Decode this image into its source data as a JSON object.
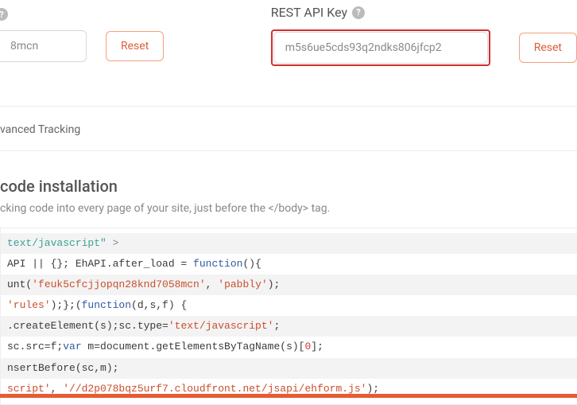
{
  "left": {
    "key_fragment": "8mcn",
    "reset_label": "Reset"
  },
  "right": {
    "label": "REST API Key",
    "key_value": "m5s6ue5cds93q2ndks806jfcp2",
    "reset_label": "Reset"
  },
  "tracking": {
    "text_fragment": "vanced Tracking"
  },
  "install": {
    "title_fragment": "code installation",
    "sub_prefix": "cking code into every page of your site, just before the",
    "sub_tag": " </body> ",
    "sub_suffix": "tag."
  },
  "code": {
    "l1": {
      "a": "text/javascript\"",
      "b": " >"
    },
    "l2": {
      "a": "API || {}; EhAPI.after_load = ",
      "b": "function",
      "c": "(){"
    },
    "l3": {
      "a": "unt(",
      "b": "'feuk5cfcjjopqn28knd7058mcn'",
      "c": ", ",
      "d": "'pabbly'",
      "e": ");"
    },
    "l4": {
      "a": "'rules'",
      "b": ");};(",
      "c": "function",
      "d": "(d,s,f) {"
    },
    "l5": {
      "a": ".createElement(s);sc.type=",
      "b": "'text/javascript'",
      "c": ";"
    },
    "l6": {
      "a": "sc.src=f;",
      "b": "var",
      "c": " m=document.getElementsByTagName(s)[",
      "d": "0",
      "e": "];"
    },
    "l7": {
      "a": "nsertBefore(sc,m);"
    },
    "l8": {
      "a": "script'",
      "b": ", ",
      "c": "'//d2p078bqz5urf7.cloudfront.net/jsapi/ehform.js'",
      "d": ");"
    }
  }
}
